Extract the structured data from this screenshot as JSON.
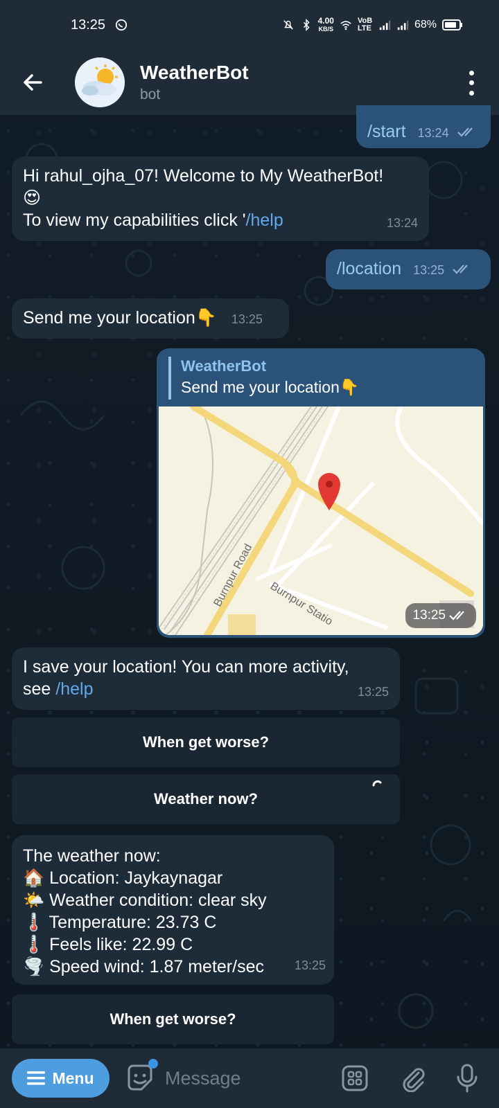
{
  "status_bar": {
    "time": "13:25",
    "net_speed": "4.00",
    "net_unit": "KB/S",
    "volte": "VoB LTE",
    "battery": "68%"
  },
  "header": {
    "title": "WeatherBot",
    "subtitle": "bot"
  },
  "messages": [
    {
      "cmd": "/start",
      "time": "13:24"
    },
    {
      "line1": "Hi rahul_ojha_07! Welcome to My WeatherBot!",
      "emoji": "😍",
      "line3_prefix": "To view my capabilities click '",
      "link": "/help",
      "time": "13:24"
    },
    {
      "cmd": "/location",
      "time": "13:25"
    },
    {
      "text": "Send me your location👇",
      "time": "13:25"
    },
    {
      "reply_name": "WeatherBot",
      "reply_text": "Send me your location👇",
      "time": "13:25",
      "map_labels": {
        "road1": "Burnpur Road",
        "road2": "Burnpur Statio"
      }
    },
    {
      "line1": "I save your location! You can more activity,",
      "line2_prefix": "see ",
      "link": "/help",
      "time": "13:25"
    },
    {
      "lines": [
        "The weather now:",
        "🏠 Location: Jaykaynagar",
        "🌤️ Weather condition: clear sky",
        "🌡️ Temperature: 23.73 C",
        "🌡️ Feels like: 22.99 C",
        "🌪️ Speed wind: 1.87 meter/sec"
      ],
      "time": "13:25"
    }
  ],
  "keyboard_buttons": {
    "b1": "When get worse?",
    "b2": "Weather now?",
    "b3": "When get worse?"
  },
  "bottom_bar": {
    "menu_label": "Menu",
    "input_placeholder": "Message"
  },
  "colors": {
    "accent": "#4d9ddf",
    "incoming_bubble": "#1e2c3a",
    "outgoing_bubble": "#2b5278",
    "link": "#62a8ea"
  }
}
